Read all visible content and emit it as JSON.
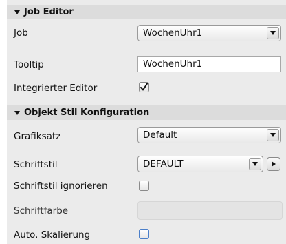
{
  "job_editor": {
    "title": "Job Editor",
    "job_label": "Job",
    "job_value": "WochenUhr1",
    "tooltip_label": "Tooltip",
    "tooltip_value": "WochenUhr1",
    "integrated_editor_label": "Integrierter Editor",
    "integrated_editor_checked": true
  },
  "style_config": {
    "title": "Objekt Stil Konfiguration",
    "graphics_label": "Grafiksatz",
    "graphics_value": "Default",
    "font_style_label": "Schriftstil",
    "font_style_value": "DEFAULT",
    "ignore_font_style_label": "Schriftstil ignorieren",
    "ignore_font_style_checked": false,
    "font_color_label": "Schriftfarbe",
    "auto_scale_label": "Auto. Skalierung",
    "auto_scale_checked": false
  },
  "icons": {
    "collapse": "triangle-down-icon",
    "dropdown": "chevron-down-icon",
    "expand": "play-right-icon",
    "check": "checkmark-icon"
  }
}
